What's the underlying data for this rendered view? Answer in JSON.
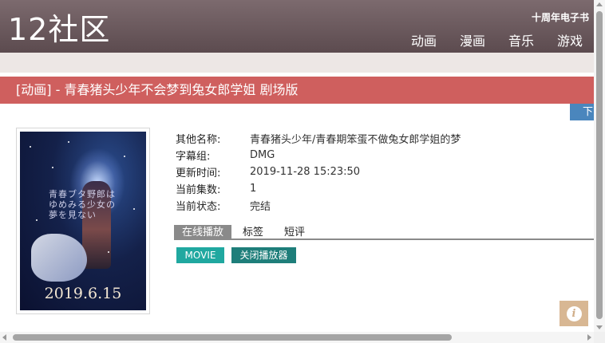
{
  "header": {
    "logo": "12社区",
    "tenth_anniv": "十周年电子书",
    "nav": [
      "动画",
      "漫画",
      "音乐",
      "游戏"
    ]
  },
  "title_bar": {
    "text": "[动画] - 青春猪头少年不会梦到兔女郎学姐 剧场版"
  },
  "download_tab": {
    "label": "下"
  },
  "poster": {
    "date": "2019.6.15",
    "vertical_text": "青春ブタ野郎は ゆめみる少女の 夢を見ない"
  },
  "info": {
    "alt_name_label": "其他名称:",
    "alt_name": "青春猪头少年/青春期笨蛋不做兔女郎学姐的梦",
    "subgroup_label": "字幕组:",
    "subgroup": "DMG",
    "updated_label": "更新时间:",
    "updated": "2019-11-28 15:23:50",
    "episodes_label": "当前集数:",
    "episodes": "1",
    "status_label": "当前状态:",
    "status": "完结"
  },
  "tabs": [
    "在线播放",
    "标签",
    "短评"
  ],
  "buttons": {
    "movie": "MOVIE",
    "close_player": "关闭播放器"
  },
  "colors": {
    "header": "#6b5a5e",
    "title_bar": "#cf5f5e",
    "download_tab": "#4a86bd",
    "movie_button": "#20a8a0",
    "close_button": "#1e7e7a",
    "info_fab": "#d8b793"
  },
  "icons": {
    "info_fab": "info-icon"
  }
}
